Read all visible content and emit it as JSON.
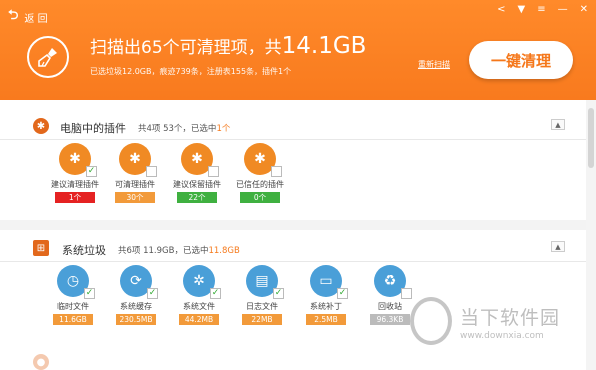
{
  "header": {
    "back_label": "返 回",
    "title_prefix": "扫描出65个可清理项，共",
    "title_size": "14.1GB",
    "subtitle": "已选垃圾12.0GB，痕迹739条，注册表155条，插件1个",
    "rescan_label": "重新扫描",
    "clean_button": "一键清理"
  },
  "section_plugins": {
    "name": "电脑中的插件",
    "stats_prefix": "共4项 53个，已选中",
    "stats_selected": "1个",
    "items": [
      {
        "label": "建议清理插件",
        "count": "1个",
        "color": "#e52222",
        "checked": true
      },
      {
        "label": "可清理插件",
        "count": "30个",
        "color": "#f29a3a",
        "checked": false
      },
      {
        "label": "建议保留插件",
        "count": "22个",
        "color": "#3fb040",
        "checked": false
      },
      {
        "label": "已信任的插件",
        "count": "0个",
        "color": "#3fb040",
        "checked": false
      }
    ]
  },
  "section_junk": {
    "name": "系统垃圾",
    "stats_prefix": "共6项 11.9GB，已选中",
    "stats_selected": "11.8GB",
    "items": [
      {
        "label": "临时文件",
        "count": "11.6GB",
        "color": "#f29a3a",
        "checked": true
      },
      {
        "label": "系统缓存",
        "count": "230.5MB",
        "color": "#f29a3a",
        "checked": true
      },
      {
        "label": "系统文件",
        "count": "44.2MB",
        "color": "#f29a3a",
        "checked": true
      },
      {
        "label": "日志文件",
        "count": "22MB",
        "color": "#f29a3a",
        "checked": true
      },
      {
        "label": "系统补丁",
        "count": "2.5MB",
        "color": "#f29a3a",
        "checked": true
      },
      {
        "label": "回收站",
        "count": "96.3KB",
        "color": "#bbbbbb",
        "checked": false
      }
    ]
  },
  "watermark": {
    "name": "当下软件园",
    "url": "www.downxia.com"
  }
}
